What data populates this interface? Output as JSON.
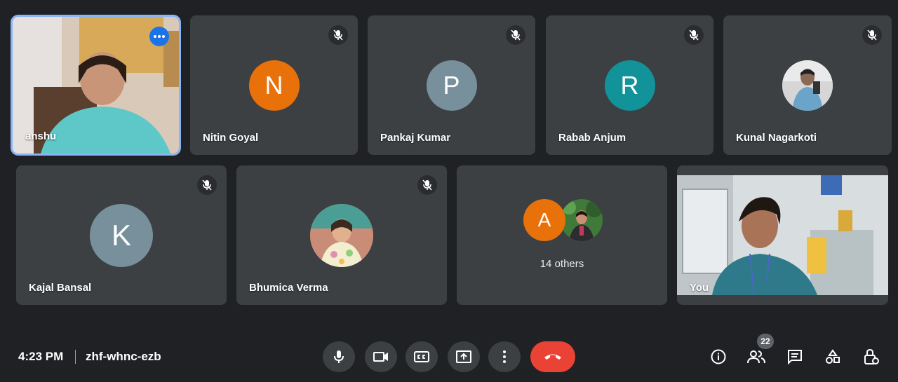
{
  "tiles": [
    {
      "name": "anshu"
    },
    {
      "name": "Nitin Goyal",
      "initial": "N",
      "color": "#e8710a"
    },
    {
      "name": "Pankaj Kumar",
      "initial": "P",
      "color": "#78909c"
    },
    {
      "name": "Rabab Anjum",
      "initial": "R",
      "color": "#12939a"
    },
    {
      "name": "Kunal Nagarkoti"
    },
    {
      "name": "Kajal Bansal",
      "initial": "K",
      "color": "#78909c"
    },
    {
      "name": "Bhumica Verma"
    },
    {
      "initial": "A",
      "color": "#e8710a",
      "label": "14 others"
    },
    {
      "name": "You"
    }
  ],
  "meeting": {
    "time": "4:23 PM",
    "code": "zhf-whnc-ezb"
  },
  "people_count": "22",
  "colors": {
    "background": "#202124",
    "tile": "#3c4043",
    "accent": "#8ab4f8",
    "end_call": "#ea4335"
  },
  "controls": [
    "mic-icon",
    "camera-icon",
    "captions-icon",
    "present-icon",
    "more-options-icon",
    "end-call-icon"
  ],
  "right_icons": [
    "info-icon",
    "people-icon",
    "chat-icon",
    "activities-icon",
    "host-controls-icon"
  ]
}
